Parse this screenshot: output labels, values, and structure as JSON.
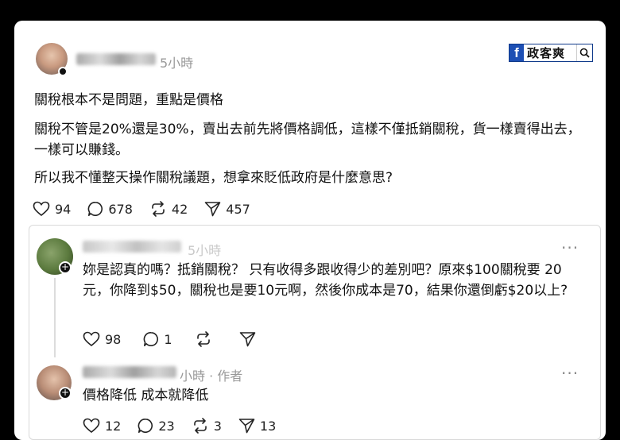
{
  "post": {
    "time": "5小時",
    "paragraphs": [
      "關稅根本不是問題，重點是價格",
      "關稅不管是20%還是30%，賣出去前先將價格調低，這樣不僅抵銷關稅，貨一樣賣得出去，一樣可以賺錢。",
      "所以我不懂整天操作關稅議題，想拿來貶低政府是什麼意思?"
    ],
    "actions": {
      "likes": "94",
      "comments": "678",
      "reposts": "42",
      "shares": "457"
    }
  },
  "brand": {
    "text": "政客爽"
  },
  "replies": [
    {
      "time": "5小時",
      "text": "妳是認真的嗎？抵銷關稅？ 只有收得多跟收得少的差別吧？原來$100關稅要 20 元，你降到$50，關稅也是要10元啊，然後你成本是70，結果你還倒虧$20以上?",
      "actions": {
        "likes": "98",
        "comments": "1"
      }
    },
    {
      "time": "小時 · 作者",
      "text": "價格降低 成本就降低",
      "actions": {
        "likes": "12",
        "comments": "23",
        "reposts": "3",
        "shares": "13"
      }
    }
  ],
  "icons": [
    "heart-icon",
    "comment-icon",
    "repost-icon",
    "share-icon",
    "more-icon",
    "search-icon",
    "facebook-icon",
    "add-follow-icon"
  ]
}
